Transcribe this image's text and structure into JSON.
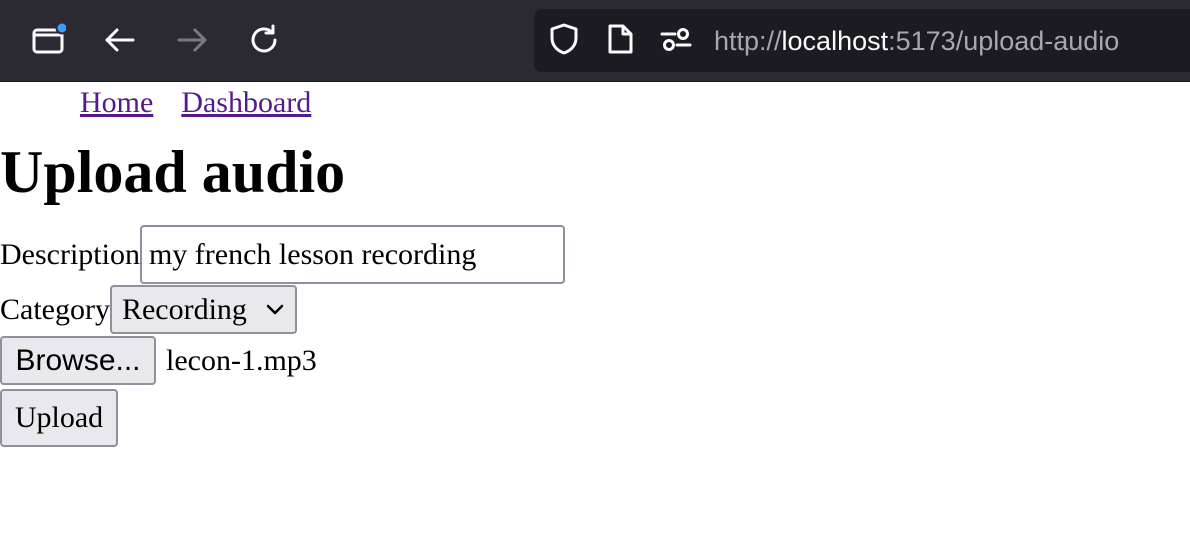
{
  "browser": {
    "url_scheme": "http://",
    "url_host": "localhost",
    "url_rest": ":5173/upload-audio",
    "icons": [
      "sidebar-icon",
      "back-arrow-icon",
      "forward-arrow-icon",
      "reload-icon",
      "shield-icon",
      "page-icon",
      "permissions-icon"
    ]
  },
  "nav": {
    "links": [
      {
        "label": "Home"
      },
      {
        "label": "Dashboard"
      }
    ]
  },
  "page": {
    "title": "Upload audio"
  },
  "form": {
    "description_label": "Description",
    "description_value": "my french lesson recording",
    "category_label": "Category",
    "category_selected": "Recording",
    "browse_label": "Browse...",
    "file_name": "lecon-1.mp3",
    "upload_label": "Upload"
  },
  "colors": {
    "toolbar_bg": "#2b2a33",
    "url_bg": "#1c1b22",
    "link_visited": "#551a8b",
    "button_bg": "#e9e9ed",
    "notification_dot": "#3b9cff"
  }
}
